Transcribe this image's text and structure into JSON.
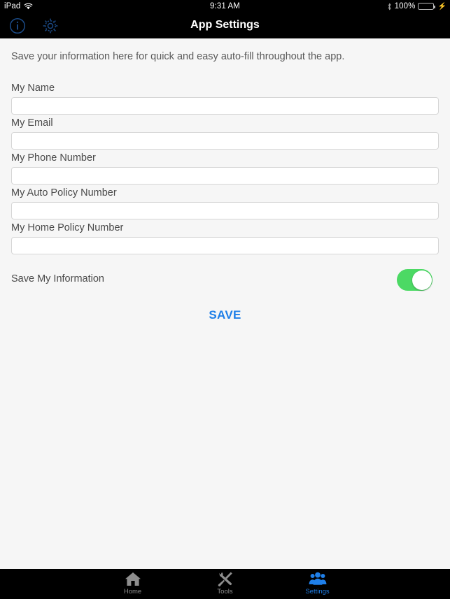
{
  "status_bar": {
    "device": "iPad",
    "wifi_icon": "wifi-icon",
    "time": "9:31 AM",
    "bluetooth_icon": "bluetooth-icon",
    "battery_percent": "100%",
    "battery_icon": "battery-full-icon",
    "charging_icon": "lightning-bolt-icon",
    "battery_color": "#4cd964"
  },
  "navbar": {
    "title": "App Settings",
    "left_buttons": [
      {
        "name": "info-icon",
        "label": "Info"
      },
      {
        "name": "gear-icon",
        "label": "Settings"
      }
    ],
    "background": "#000000",
    "icon_color": "#14386e"
  },
  "main": {
    "intro_text": "Save your information here for quick and easy auto-fill throughout the app.",
    "fields": [
      {
        "label": "My Name",
        "value": "",
        "placeholder": ""
      },
      {
        "label": "My Email",
        "value": "",
        "placeholder": ""
      },
      {
        "label": "My Phone Number",
        "value": "",
        "placeholder": ""
      },
      {
        "label": "My Auto Policy Number",
        "value": "",
        "placeholder": ""
      },
      {
        "label": "My Home Policy Number",
        "value": "",
        "placeholder": ""
      }
    ],
    "toggle": {
      "label": "Save My Information",
      "state": "on",
      "on_color": "#4cd964"
    },
    "save_button": {
      "label": "SAVE",
      "color": "#1e7fe8"
    }
  },
  "tabbar": {
    "active_color": "#1f7fe8",
    "inactive_color": "#8e8e8e",
    "tabs": [
      {
        "label": "Home",
        "icon": "house-icon",
        "active": false
      },
      {
        "label": "Tools",
        "icon": "wrench-screwdriver-icon",
        "active": false
      },
      {
        "label": "Settings",
        "icon": "people-group-icon",
        "active": true
      }
    ]
  }
}
